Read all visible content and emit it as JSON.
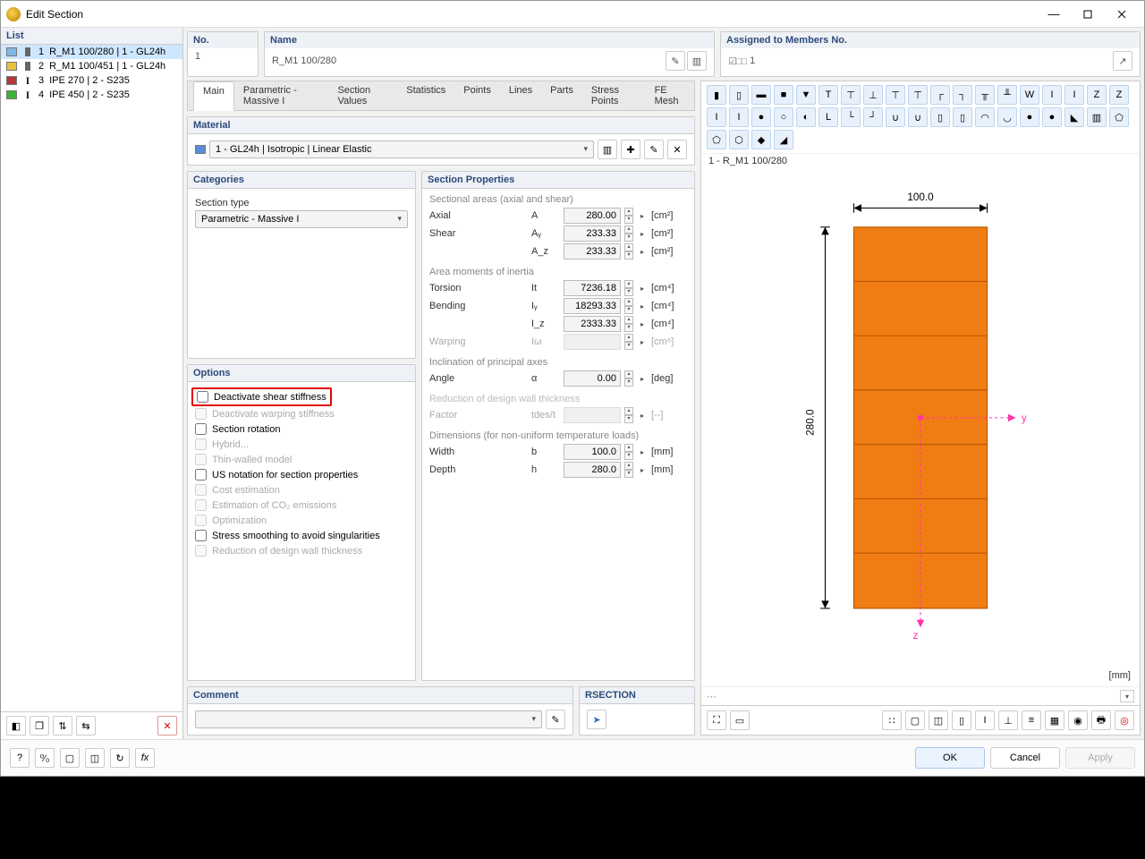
{
  "window": {
    "title": "Edit Section"
  },
  "list": {
    "header": "List",
    "items": [
      {
        "idx": "1",
        "name": "R_M1 100/280 | 1 - GL24h",
        "swatch": "#7db7e8",
        "shape": "rect",
        "active": true
      },
      {
        "idx": "2",
        "name": "R_M1 100/451 | 1 - GL24h",
        "swatch": "#e8c23c",
        "shape": "rect",
        "active": false
      },
      {
        "idx": "3",
        "name": "IPE 270 | 2 - S235",
        "swatch": "#b23a3a",
        "shape": "i",
        "active": false
      },
      {
        "idx": "4",
        "name": "IPE 450 | 2 - S235",
        "swatch": "#3fb23a",
        "shape": "i",
        "active": false
      }
    ]
  },
  "top": {
    "no_label": "No.",
    "no_value": "1",
    "name_label": "Name",
    "name_value": "R_M1 100/280",
    "members_label": "Assigned to Members No.",
    "members_value": "1",
    "members_prefix": "☑□□"
  },
  "tabs": [
    "Main",
    "Parametric - Massive I",
    "Section Values",
    "Statistics",
    "Points",
    "Lines",
    "Parts",
    "Stress Points",
    "FE Mesh"
  ],
  "active_tab": 0,
  "material": {
    "header": "Material",
    "value": "1 - GL24h | Isotropic | Linear Elastic",
    "swatch": "#5a8fd6"
  },
  "categories": {
    "header": "Categories",
    "type_label": "Section type",
    "type_value": "Parametric - Massive I"
  },
  "options": {
    "header": "Options",
    "items": [
      {
        "label": "Deactivate shear stiffness",
        "checked": false,
        "enabled": true,
        "highlight": true
      },
      {
        "label": "Deactivate warping stiffness",
        "checked": false,
        "enabled": false
      },
      {
        "label": "Section rotation",
        "checked": false,
        "enabled": true
      },
      {
        "label": "Hybrid...",
        "checked": false,
        "enabled": false
      },
      {
        "label": "Thin-walled model",
        "checked": false,
        "enabled": false
      },
      {
        "label": "US notation for section properties",
        "checked": false,
        "enabled": true
      },
      {
        "label": "Cost estimation",
        "checked": false,
        "enabled": false
      },
      {
        "label": "Estimation of CO₂ emissions",
        "checked": false,
        "enabled": false
      },
      {
        "label": "Optimization",
        "checked": false,
        "enabled": false
      },
      {
        "label": "Stress smoothing to avoid singularities",
        "checked": false,
        "enabled": true
      },
      {
        "label": "Reduction of design wall thickness",
        "checked": false,
        "enabled": false
      }
    ]
  },
  "props": {
    "header": "Section Properties",
    "groups": [
      {
        "title": "Sectional areas (axial and shear)",
        "rows": [
          {
            "label": "Axial",
            "sym": "A",
            "val": "280.00",
            "unit": "[cm²]"
          },
          {
            "label": "Shear",
            "sym": "Aᵧ",
            "val": "233.33",
            "unit": "[cm²]"
          },
          {
            "label": "",
            "sym": "A_z",
            "val": "233.33",
            "unit": "[cm²]"
          }
        ]
      },
      {
        "title": "Area moments of inertia",
        "rows": [
          {
            "label": "Torsion",
            "sym": "It",
            "val": "7236.18",
            "unit": "[cm⁴]"
          },
          {
            "label": "Bending",
            "sym": "Iᵧ",
            "val": "18293.33",
            "unit": "[cm⁴]"
          },
          {
            "label": "",
            "sym": "I_z",
            "val": "2333.33",
            "unit": "[cm⁴]"
          },
          {
            "label": "Warping",
            "sym": "Iω",
            "val": "",
            "unit": "[cm⁶]",
            "disabled": true
          }
        ]
      },
      {
        "title": "Inclination of principal axes",
        "rows": [
          {
            "label": "Angle",
            "sym": "α",
            "val": "0.00",
            "unit": "[deg]"
          }
        ]
      },
      {
        "title": "Reduction of design wall thickness",
        "disabled": true,
        "rows": [
          {
            "label": "Factor",
            "sym": "tdes/t",
            "val": "",
            "unit": "[--]",
            "disabled": true
          }
        ]
      },
      {
        "title": "Dimensions (for non-uniform temperature loads)",
        "rows": [
          {
            "label": "Width",
            "sym": "b",
            "val": "100.0",
            "unit": "[mm]"
          },
          {
            "label": "Depth",
            "sym": "h",
            "val": "280.0",
            "unit": "[mm]"
          }
        ]
      }
    ]
  },
  "preview": {
    "title": "1 - R_M1 100/280",
    "width_label": "100.0",
    "height_label": "280.0",
    "y_label": "y",
    "z_label": "z",
    "unit": "[mm]"
  },
  "comment": {
    "header": "Comment"
  },
  "rsection": {
    "header": "RSECTION"
  },
  "footer": {
    "ok": "OK",
    "cancel": "Cancel",
    "apply": "Apply"
  }
}
